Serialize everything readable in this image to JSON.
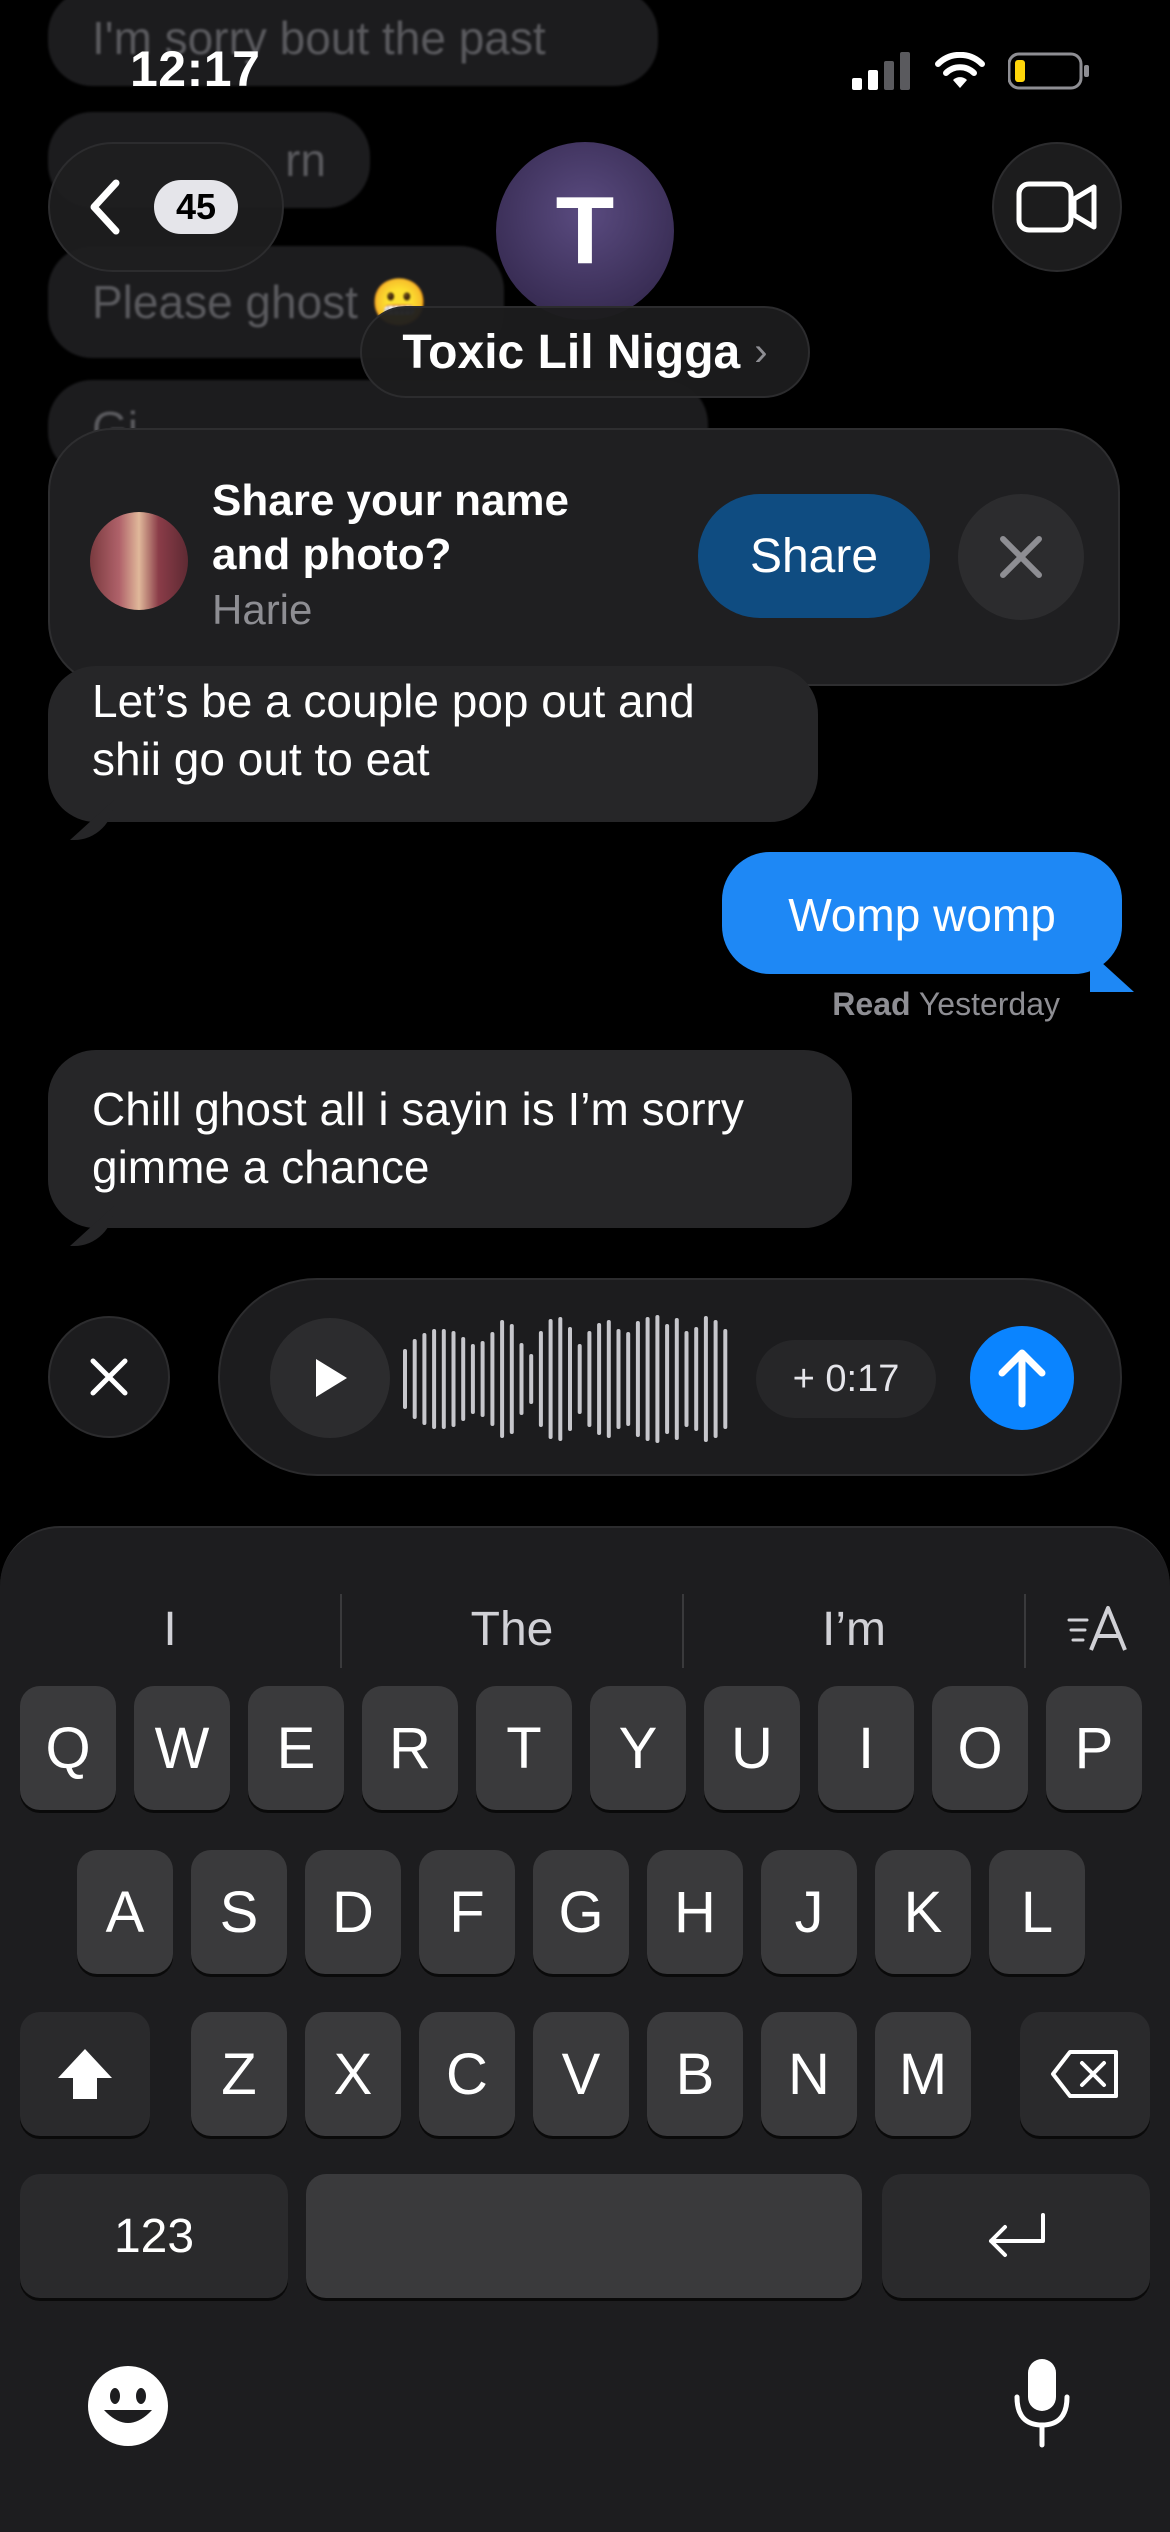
{
  "status_bar": {
    "time": "12:17"
  },
  "faded_messages": [
    "I'm sorry bout the past",
    "rn",
    "Please ghost 😬",
    "Gi"
  ],
  "header": {
    "back_count": "45",
    "contact_initial": "T",
    "contact_name": "Toxic Lil Nigga",
    "name_chevron": "›"
  },
  "share_banner": {
    "title": "Share your name and photo?",
    "subtitle": "Harie",
    "share_label": "Share"
  },
  "messages": [
    {
      "direction": "incoming",
      "text": "Let’s be a couple pop out and shii go out to eat"
    },
    {
      "direction": "outgoing",
      "text": "Womp womp"
    },
    {
      "direction": "incoming",
      "text": "Chill ghost all i sayin is I’m sorry gimme a chance"
    }
  ],
  "read_receipt": {
    "status": "Read",
    "when": "Yesterday"
  },
  "voice_recording": {
    "duration": "+ 0:17"
  },
  "keyboard": {
    "suggestions": [
      "I",
      "The",
      "I’m"
    ],
    "row1": [
      "Q",
      "W",
      "E",
      "R",
      "T",
      "Y",
      "U",
      "I",
      "O",
      "P"
    ],
    "row2": [
      "A",
      "S",
      "D",
      "F",
      "G",
      "H",
      "J",
      "K",
      "L"
    ],
    "row3": [
      "Z",
      "X",
      "C",
      "V",
      "B",
      "N",
      "M"
    ],
    "numbers_label": "123"
  },
  "icons": {
    "back": "chevron-left-icon",
    "video": "video-camera-icon",
    "close": "close-icon",
    "play": "play-icon",
    "send": "arrow-up-icon",
    "shift": "shift-icon",
    "delete": "delete-icon",
    "return": "return-icon",
    "emoji": "emoji-icon",
    "mic": "microphone-icon",
    "text_format": "text-format-icon"
  },
  "colors": {
    "accent_blue": "#0a84ff",
    "outgoing_bubble": "#1e88f5",
    "incoming_bubble": "#262628",
    "share_button": "#0f4c81",
    "battery_low": "#ffd60a"
  }
}
